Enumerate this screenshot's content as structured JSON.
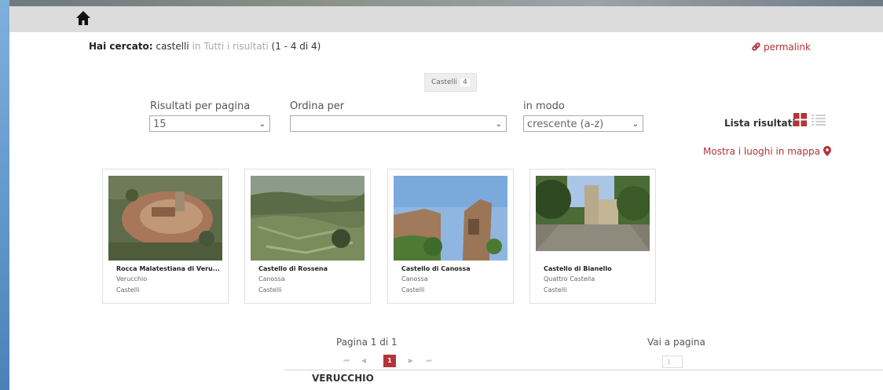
{
  "header": {
    "home_icon": "home-icon"
  },
  "search": {
    "label": "Hai cercato:",
    "query": "castelli",
    "in_word": "in",
    "scope": "Tutti i risultati",
    "range": "(1 - 4 di 4)"
  },
  "permalink": {
    "label": "permalink",
    "icon": "link-icon"
  },
  "facet": {
    "label": "Castelli",
    "count": "4"
  },
  "controls": {
    "per_page_label": "Risultati per pagina",
    "per_page_value": "15",
    "order_label": "Ordina per",
    "order_value": "",
    "mode_label": "in modo",
    "mode_value": "crescente (a-z)"
  },
  "view": {
    "label": "Lista risultati:",
    "grid_icon": "grid-view-icon",
    "list_icon": "list-view-icon"
  },
  "map_link": {
    "label": "Mostra i luoghi in mappa",
    "icon": "map-pin-icon"
  },
  "results": [
    {
      "title": "Rocca Malatestiana di Veru...",
      "place": "Verucchio",
      "category": "Castelli"
    },
    {
      "title": "Castello di Rossena",
      "place": "Canossa",
      "category": "Castelli"
    },
    {
      "title": "Castello di Canossa",
      "place": "Canossa",
      "category": "Castelli"
    },
    {
      "title": "Castello di Bianello",
      "place": "Quattro Castella",
      "category": "Castelli"
    }
  ],
  "pagination": {
    "label": "Pagina 1 di 1",
    "first": "⏮",
    "prev": "◀",
    "current": "1",
    "next": "▶",
    "last": "⏭",
    "goto_label": "Vai a pagina",
    "goto_value": "1"
  },
  "section": {
    "title": "VERUCCHIO"
  },
  "colors": {
    "accent": "#b5323a",
    "topbar": "#dcdcdc"
  }
}
